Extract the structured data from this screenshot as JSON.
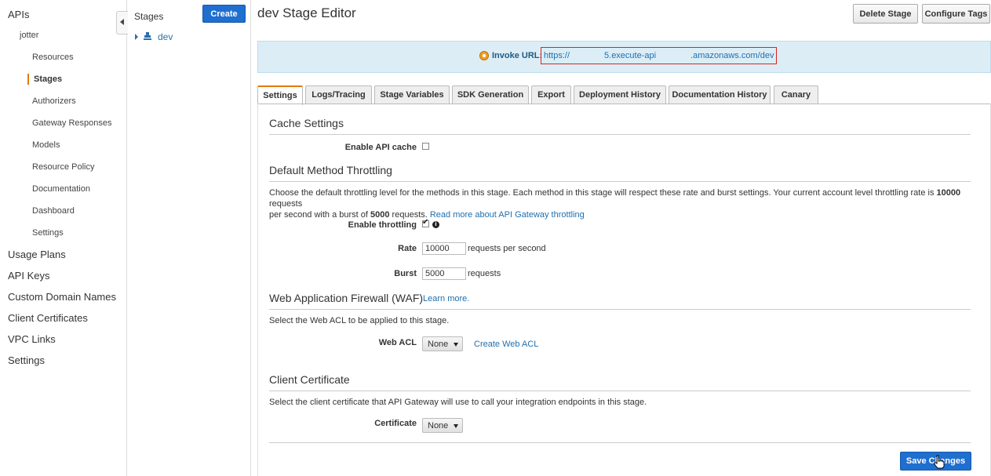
{
  "nav": {
    "apis": "APIs",
    "api_name": "jotter",
    "sub_items": [
      "Resources",
      "Stages",
      "Authorizers",
      "Gateway Responses",
      "Models",
      "Resource Policy",
      "Documentation",
      "Dashboard",
      "Settings"
    ],
    "top_items": [
      "Usage Plans",
      "API Keys",
      "Custom Domain Names",
      "Client Certificates",
      "VPC Links",
      "Settings"
    ]
  },
  "stages": {
    "title": "Stages",
    "create_label": "Create",
    "items": [
      "dev"
    ]
  },
  "editor": {
    "title": "dev Stage Editor",
    "delete_label": "Delete Stage",
    "tags_label": "Configure Tags",
    "invoke_label": "Invoke URL:",
    "invoke_url": "https://    5.execute-api    .amazonaws.com/dev"
  },
  "tabs": [
    "Settings",
    "Logs/Tracing",
    "Stage Variables",
    "SDK Generation",
    "Export",
    "Deployment History",
    "Documentation History",
    "Canary"
  ],
  "cache": {
    "title": "Cache Settings",
    "enable_label": "Enable API cache",
    "enabled": false
  },
  "throttling": {
    "title": "Default Method Throttling",
    "desc_1": "Choose the default throttling level for the methods in this stage. Each method in this stage will respect these rate and burst settings. Your current account level throttling rate is ",
    "rate_bold": "10000",
    "desc_2": " requests",
    "desc_3": "per second with a burst of ",
    "burst_bold": "5000",
    "desc_4": " requests. ",
    "read_more": "Read more about API Gateway throttling",
    "enable_label": "Enable throttling",
    "enabled": true,
    "rate_label": "Rate",
    "rate_value": "10000",
    "rate_unit": "requests per second",
    "burst_label": "Burst",
    "burst_value": "5000",
    "burst_unit": "requests"
  },
  "waf": {
    "title": "Web Application Firewall (WAF)",
    "learn_more": "Learn more.",
    "desc": "Select the Web ACL to be applied to this stage.",
    "acl_label": "Web ACL",
    "acl_value": "None",
    "create_link": "Create Web ACL"
  },
  "client_cert": {
    "title": "Client Certificate",
    "desc": "Select the client certificate that API Gateway will use to call your integration endpoints in this stage.",
    "cert_label": "Certificate",
    "cert_value": "None"
  },
  "save_label": "Save Changes"
}
